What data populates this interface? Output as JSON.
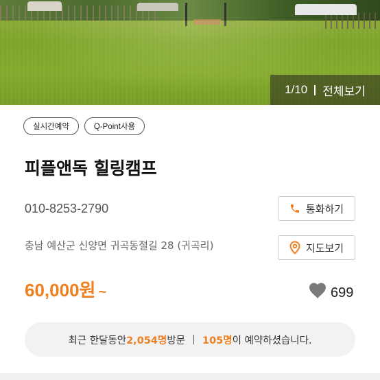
{
  "gallery": {
    "current": "1",
    "total": "10",
    "counter_text": "1/10",
    "view_all_label": "전체보기"
  },
  "tags": [
    "실시간예약",
    "Q-Point사용"
  ],
  "place": {
    "name": "피플앤독 힐링캠프",
    "phone": "010-8253-2790",
    "address": "충남 예산군 신양면 귀곡동절길 28 (귀곡리)"
  },
  "actions": {
    "call_label": "통화하기",
    "map_label": "지도보기"
  },
  "price": {
    "amount": "60,000원",
    "suffix": "~"
  },
  "likes": {
    "count": "699"
  },
  "stats": {
    "prefix": "최근 한달동안 ",
    "visits": "2,054명",
    "visits_suffix": "방문",
    "reservations": "105명",
    "reservations_suffix": "이 예약하셨습니다."
  },
  "colors": {
    "accent": "#f07f1d",
    "map_pin": "#f07f1d",
    "heart": "#7a7a7a"
  },
  "icons": {
    "call": "phone-icon",
    "map": "map-pin-icon",
    "like": "heart-icon"
  }
}
